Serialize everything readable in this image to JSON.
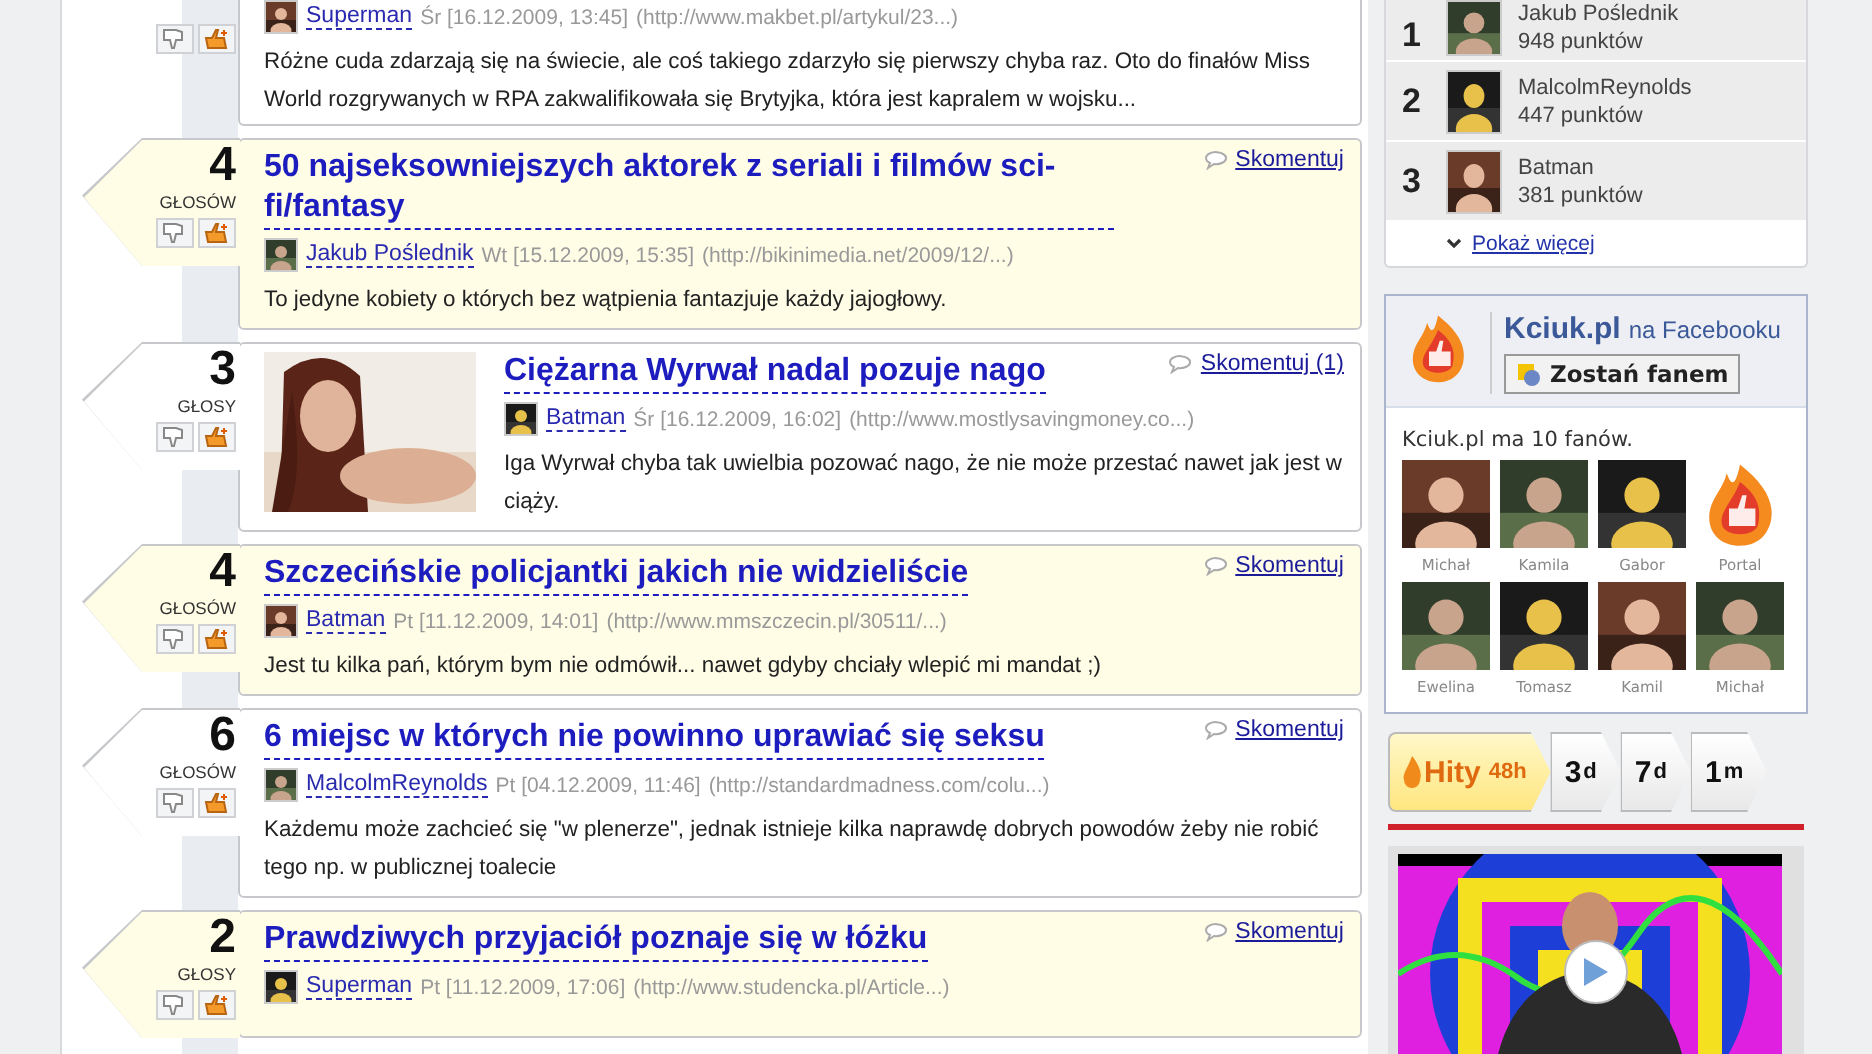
{
  "posts": [
    {
      "highlighted": false,
      "author": "Superman",
      "day": "Śr",
      "date": "[16.12.2009, 13:45]",
      "url": "(http://www.makbet.pl/artykul/23...)",
      "text": "Różne cuda zdarzają się na świecie, ale coś takiego zdarzyło się pierwszy chyba raz. Oto do finałów Miss World rozgrywanych w RPA zakwalifikowała się Brytyjka, która jest kapralem w wojsku..."
    },
    {
      "highlighted": true,
      "votes": "4",
      "votes_label": "GŁOSÓW",
      "title": "50 najseksowniejszych aktorek z seriali i filmów sci-fi/fantasy",
      "comment_link": "Skomentuj",
      "author": "Jakub Poślednik",
      "day": "Wt",
      "date": "[15.12.2009, 15:35]",
      "url": "(http://bikinimedia.net/2009/12/...)",
      "text": "To jedyne kobiety o których bez wątpienia fantazjuje każdy jajogłowy."
    },
    {
      "highlighted": false,
      "thumbnail": true,
      "votes": "3",
      "votes_label": "GŁOSY",
      "title": "Ciężarna Wyrwał nadal pozuje nago",
      "comment_link": "Skomentuj (1)",
      "author": "Batman",
      "day": "Śr",
      "date": "[16.12.2009, 16:02]",
      "url": "(http://www.mostlysavingmoney.co...)",
      "text": "Iga Wyrwał chyba tak uwielbia pozować nago, że nie może przestać nawet jak jest w ciąży."
    },
    {
      "highlighted": true,
      "votes": "4",
      "votes_label": "GŁOSÓW",
      "title": "Szczecińskie policjantki jakich nie widzieliście",
      "comment_link": "Skomentuj",
      "author": "Batman",
      "day": "Pt",
      "date": "[11.12.2009, 14:01]",
      "url": "(http://www.mmszczecin.pl/30511/...)",
      "text": "Jest tu kilka pań, którym bym nie odmówił... nawet gdyby chciały wlepić mi mandat ;)"
    },
    {
      "highlighted": false,
      "votes": "6",
      "votes_label": "GŁOSÓW",
      "title": "6 miejsc w których nie powinno uprawiać się seksu",
      "comment_link": "Skomentuj",
      "author": "MalcolmReynolds",
      "day": "Pt",
      "date": "[04.12.2009, 11:46]",
      "url": "(http://standardmadness.com/colu...)",
      "text": "Każdemu może zachcieć się \"w plenerze\", jednak istnieje kilka naprawdę dobrych powodów żeby nie robić tego np. w publicznej toalecie"
    },
    {
      "highlighted": true,
      "votes": "2",
      "votes_label": "GŁOSY",
      "title": "Prawdziwych przyjaciół poznaje się w łóżku",
      "comment_link": "Skomentuj",
      "author": "Superman",
      "day": "Pt",
      "date": "[11.12.2009, 17:06]",
      "url": "(http://www.studencka.pl/Article...)"
    }
  ],
  "ranking": {
    "rows": [
      {
        "rank": "1",
        "name": "Jakub Poślednik",
        "points": "948 punktów"
      },
      {
        "rank": "2",
        "name": "MalcolmReynolds",
        "points": "447 punktów"
      },
      {
        "rank": "3",
        "name": "Batman",
        "points": "381 punktów"
      }
    ],
    "more_link": "Pokaż więcej"
  },
  "facebook": {
    "site": "Kciuk.pl",
    "suffix": "na Facebooku",
    "fan_button": "Zostań fanem",
    "fan_count": "Kciuk.pl ma 10 fanów.",
    "fans": [
      {
        "name": "Michał"
      },
      {
        "name": "Kamila"
      },
      {
        "name": "Gabor"
      },
      {
        "name": "Portal",
        "kind": "logo"
      },
      {
        "name": "Ewelina"
      },
      {
        "name": "Tomasz"
      },
      {
        "name": "Kamil"
      },
      {
        "name": "Michał"
      }
    ]
  },
  "hit_tabs": [
    {
      "main": "Hity",
      "unit": "48h",
      "selected": true
    },
    {
      "main": "3",
      "unit": "d",
      "selected": false
    },
    {
      "main": "7",
      "unit": "d",
      "selected": false
    },
    {
      "main": "1",
      "unit": "m",
      "selected": false
    }
  ]
}
